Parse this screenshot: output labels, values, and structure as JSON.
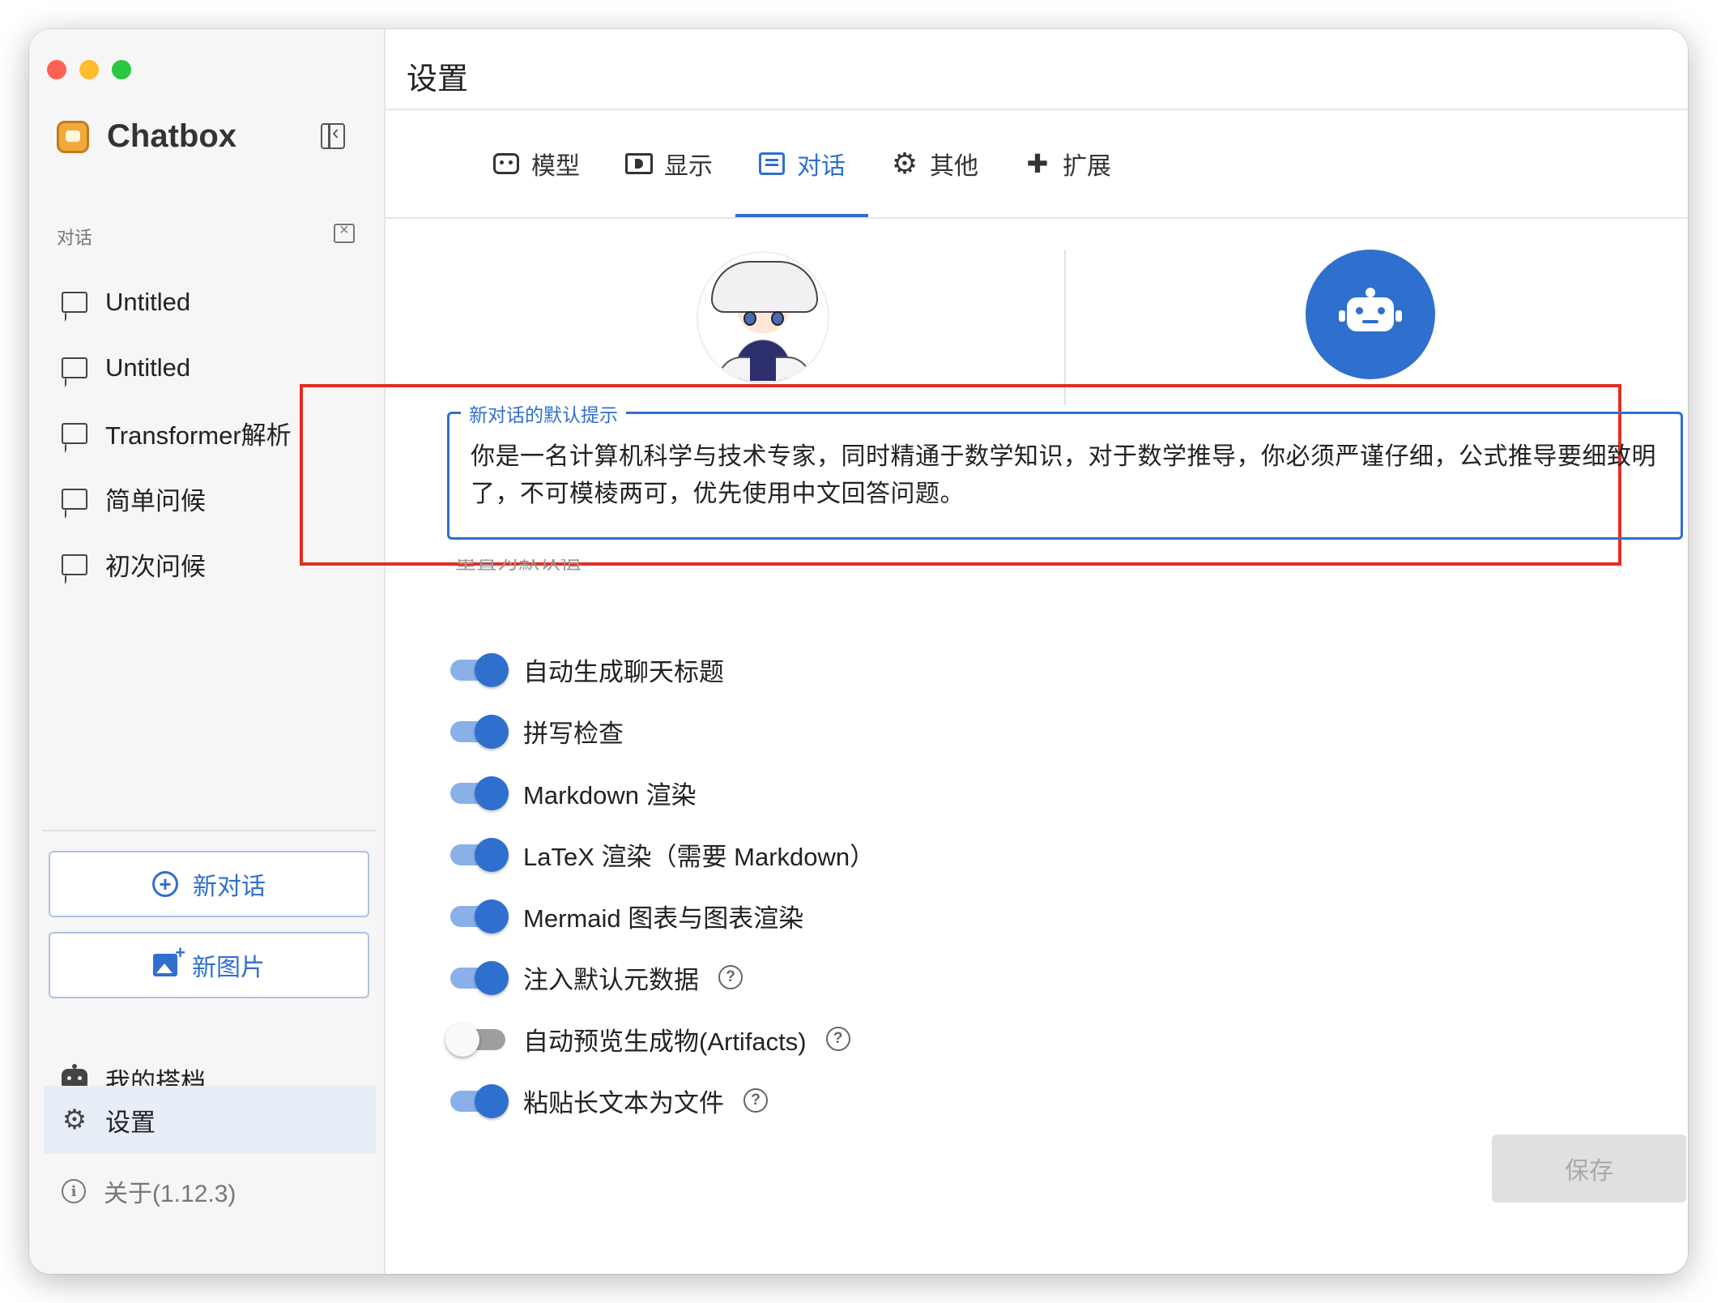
{
  "app": {
    "name": "Chatbox",
    "version_label": "关于(1.12.3)"
  },
  "sidebar": {
    "section_label": "对话",
    "conversations": [
      {
        "label": "Untitled"
      },
      {
        "label": "Untitled"
      },
      {
        "label": "Transformer解析"
      },
      {
        "label": "简单问候"
      },
      {
        "label": "初次问候"
      }
    ],
    "new_chat_label": "新对话",
    "new_image_label": "新图片",
    "partners_label": "我的搭档",
    "settings_label": "设置"
  },
  "settings": {
    "title": "设置",
    "tabs": [
      {
        "label": "模型",
        "icon": "robot-icon"
      },
      {
        "label": "显示",
        "icon": "display-icon"
      },
      {
        "label": "对话",
        "icon": "chat-icon",
        "active": true
      },
      {
        "label": "其他",
        "icon": "gear-icon"
      },
      {
        "label": "扩展",
        "icon": "puzzle-icon"
      }
    ],
    "prompt": {
      "legend": "新对话的默认提示",
      "value": "你是一名计算机科学与技术专家，同时精通于数学知识，对于数学推导，你必须严谨仔细，公式推导要细致明了，不可模棱两可，优先使用中文回答问题。"
    },
    "reset_label": "重置为默认值",
    "toggles": [
      {
        "label": "自动生成聊天标题",
        "on": true,
        "help": false
      },
      {
        "label": "拼写检查",
        "on": true,
        "help": false
      },
      {
        "label": "Markdown 渲染",
        "on": true,
        "help": false
      },
      {
        "label": "LaTeX 渲染（需要 Markdown）",
        "on": true,
        "help": false
      },
      {
        "label": "Mermaid 图表与图表渲染",
        "on": true,
        "help": false
      },
      {
        "label": "注入默认元数据",
        "on": true,
        "help": true
      },
      {
        "label": "自动预览生成物(Artifacts)",
        "on": false,
        "help": true
      },
      {
        "label": "粘贴长文本为文件",
        "on": true,
        "help": true
      }
    ],
    "save_label": "保存"
  },
  "colors": {
    "accent": "#2f6fce",
    "highlight": "#e02f23"
  }
}
